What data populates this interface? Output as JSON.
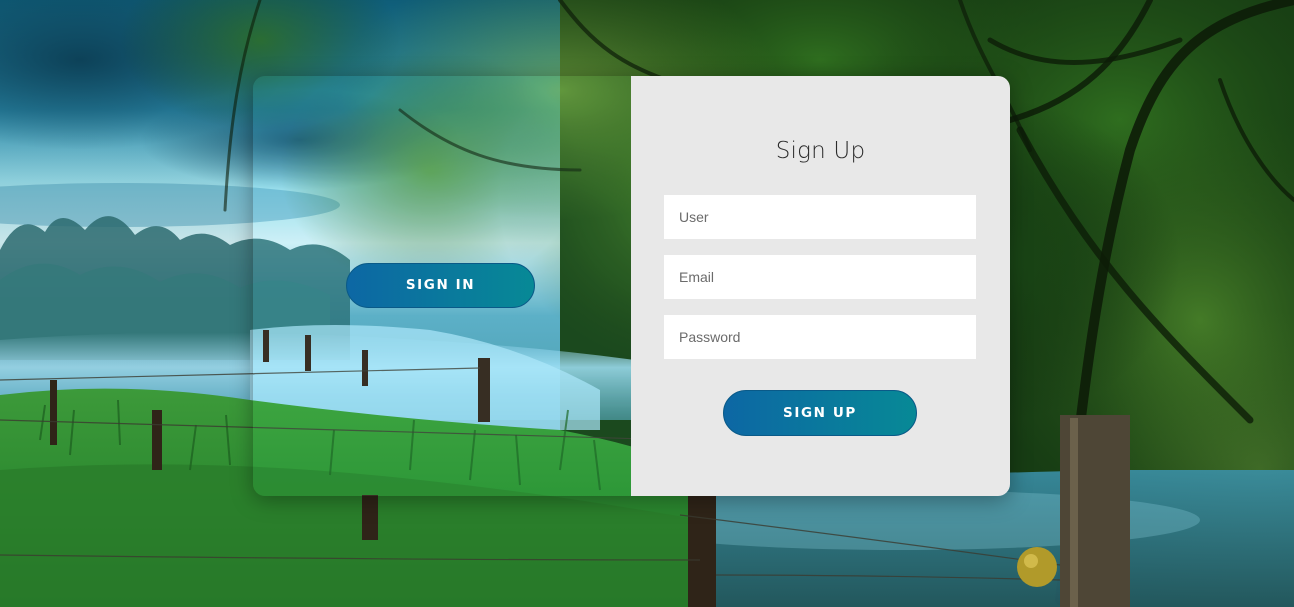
{
  "left_panel": {
    "signin_label": "SIGN IN"
  },
  "signup_form": {
    "title": "Sign Up",
    "fields": {
      "user": {
        "placeholder": "User",
        "value": ""
      },
      "email": {
        "placeholder": "Email",
        "value": ""
      },
      "password": {
        "placeholder": "Password",
        "value": ""
      }
    },
    "submit_label": "SIGN UP"
  },
  "colors": {
    "button_gradient_start": "#0d67a4",
    "button_gradient_end": "#078996",
    "form_background": "#e8e8e8",
    "field_background": "#ffffff",
    "title_color": "#2b2b2b"
  }
}
